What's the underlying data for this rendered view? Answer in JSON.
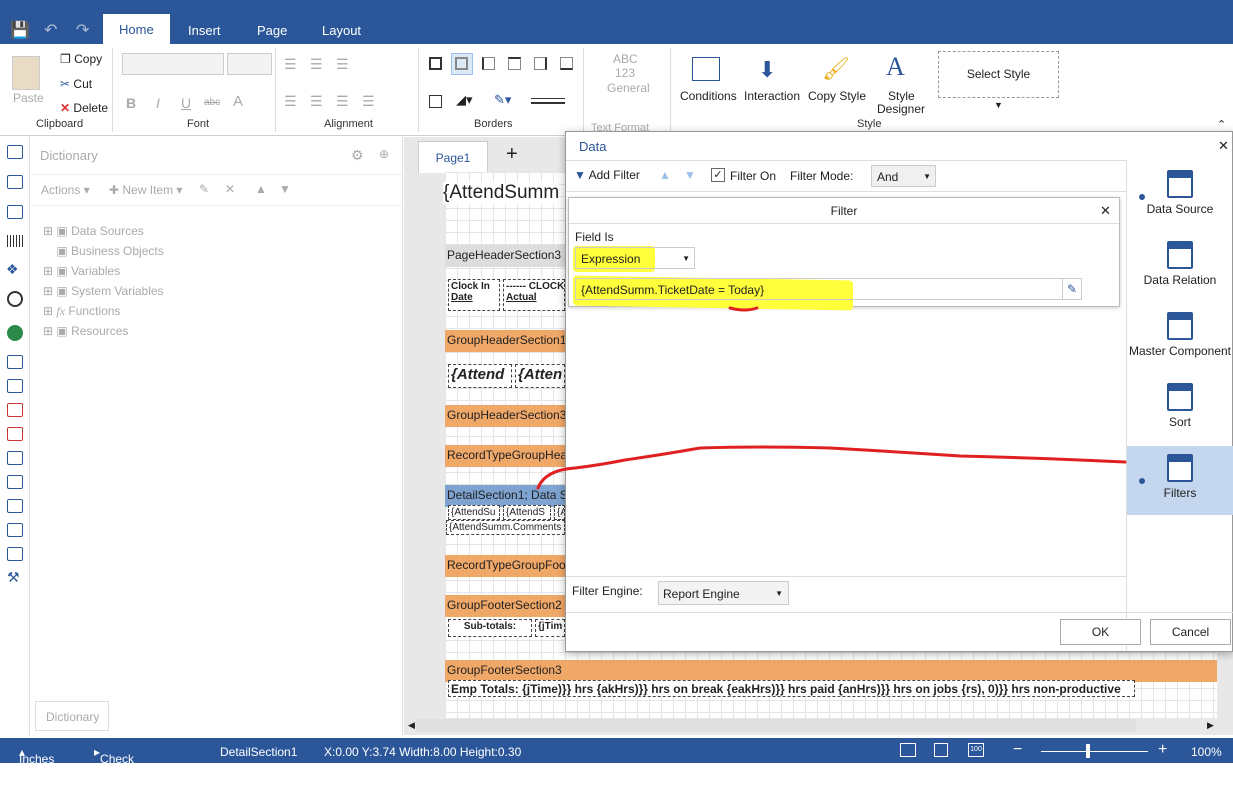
{
  "titlebar": {
    "tabs": [
      "Home",
      "Insert",
      "Page",
      "Layout"
    ]
  },
  "ribbon": {
    "clipboard": {
      "paste": "Paste",
      "copy": "Copy",
      "cut": "Cut",
      "delete": "Delete",
      "group": "Clipboard"
    },
    "font": {
      "group": "Font"
    },
    "alignment": {
      "group": "Alignment"
    },
    "borders": {
      "group": "Borders"
    },
    "textformat": {
      "abc": "ABC",
      "num": "123",
      "general": "General",
      "group": "Text Format"
    },
    "style": {
      "conditions": "Conditions",
      "interaction": "Interaction",
      "copy_style": "Copy Style",
      "style_designer_1": "Style",
      "style_designer_2": "Designer",
      "select_style": "Select Style",
      "group": "Style"
    }
  },
  "dictionary": {
    "title": "Dictionary",
    "actions": "Actions",
    "new_item": "New Item",
    "items": [
      "Data Sources",
      "Business Objects",
      "Variables",
      "System Variables",
      "Functions",
      "Resources"
    ],
    "fx": "fx",
    "tab": "Dictionary"
  },
  "designer": {
    "page_tab": "Page1",
    "add": "+",
    "header_text": "{AttendSumm",
    "bands": [
      "PageHeaderSection3",
      "GroupHeaderSection1",
      "GroupHeaderSection3",
      "RecordTypeGroupHea",
      "DetailSection1; Data S",
      "RecordTypeGroupFoo",
      "GroupFooterSection2",
      "GroupFooterSection3"
    ],
    "cells": {
      "clock_in_1": "Clock In",
      "clock_in_2": "Date",
      "clock_hdr": "------ CLOCK",
      "actual": "Actual",
      "attend1": "{Attend",
      "attend2": "{Atten",
      "d1": "{AttendSu",
      "d2": "{AttendS",
      "d3": "{A",
      "comments": "{AttendSumm.Comments",
      "subtotals": "Sub-totals:",
      "subtime": "{jTim",
      "footer_row": "Emp Totals:  {jTime)}} hrs  {akHrs)}} hrs on break  {eakHrs)}} hrs paid  {anHrs)}} hrs on jobs  {rs), 0)}} hrs non-productive"
    }
  },
  "dialog": {
    "title": "Data",
    "toolbar": {
      "add_filter": "Add Filter",
      "filter_on": "Filter On",
      "filter_mode": "Filter Mode:",
      "mode_value": "And"
    },
    "filter": {
      "title": "Filter",
      "field_is": "Field Is",
      "field_value": "Expression",
      "expression": "{AttendSumm.TicketDate = Today}"
    },
    "engine_label": "Filter Engine:",
    "engine_value": "Report Engine",
    "ok": "OK",
    "cancel": "Cancel",
    "sidebar": [
      "Data Source",
      "Data Relation",
      "Master Component",
      "Sort",
      "Filters"
    ]
  },
  "status": {
    "units": "Inches",
    "check": "Check for Issues",
    "section": "DetailSection1",
    "coords": "X:0.00 Y:3.74 Width:8.00 Height:0.30",
    "zoom": "100%",
    "minus": "−",
    "plus": "+"
  },
  "colors": {
    "accent": "#2b579a",
    "band_orange": "#f0a868",
    "highlight": "#ffff3c",
    "annotation": "#e02020"
  }
}
